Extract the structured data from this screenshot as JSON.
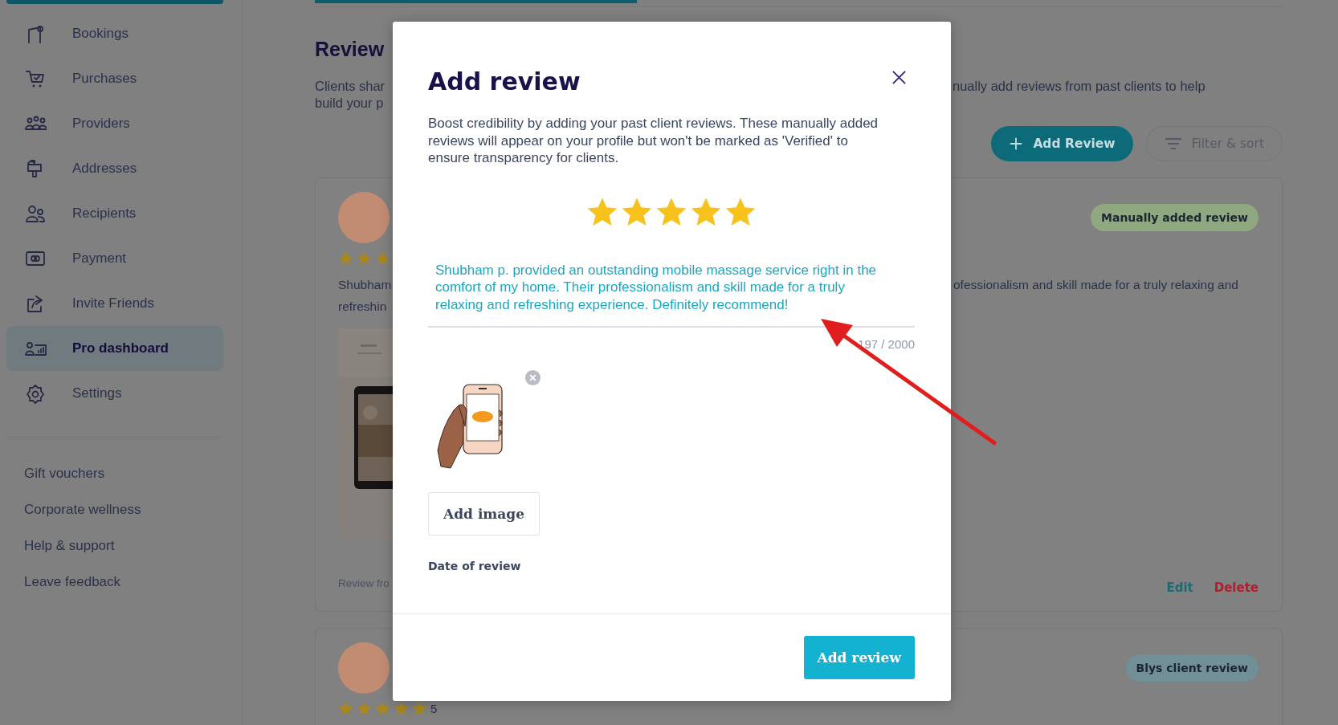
{
  "sidebar": {
    "items": [
      {
        "label": "Bookings",
        "selected": false
      },
      {
        "label": "Purchases",
        "selected": false
      },
      {
        "label": "Providers",
        "selected": false
      },
      {
        "label": "Addresses",
        "selected": false
      },
      {
        "label": "Recipients",
        "selected": false
      },
      {
        "label": "Payment",
        "selected": false
      },
      {
        "label": "Invite Friends",
        "selected": false
      },
      {
        "label": "Pro dashboard",
        "selected": true
      },
      {
        "label": "Settings",
        "selected": false
      }
    ],
    "links": [
      "Gift vouchers",
      "Corporate wellness",
      "Help & support",
      "Leave feedback"
    ]
  },
  "page": {
    "heading": "Review",
    "description_left": [
      "Clients shar",
      "build your p"
    ],
    "description_right": "nually add reviews from past clients to help",
    "add_button": "Add Review",
    "filter_button": "Filter & sort"
  },
  "reviews": [
    {
      "kind": "manual",
      "badge": "Manually added review",
      "stars": 3,
      "text_left": [
        "Shubham",
        "refreshin"
      ],
      "text_right": "ofessionalism and skill made for a truly relaxing and",
      "source": "Review fro",
      "actions": [
        {
          "label": "Edit",
          "kind": "edit"
        },
        {
          "label": "Delete",
          "kind": "delete"
        }
      ]
    },
    {
      "kind": "client",
      "badge": "Blys client review",
      "stars": 5,
      "rating": "5"
    }
  ],
  "modal": {
    "title": "Add review",
    "intro": "Boost credibility by adding your past client reviews. These manually added reviews will appear on your profile but won't be marked as 'Verified' to ensure transparency for clients.",
    "stars": 5,
    "review_text": "Shubham p. provided an outstanding mobile massage service right in the comfort of my home. Their professionalism and skill made for a truly relaxing and refreshing experience. Definitely recommend!",
    "counter": "197 / 2000",
    "add_image": "Add image",
    "date_label": "Date of review",
    "submit": "Add review"
  }
}
